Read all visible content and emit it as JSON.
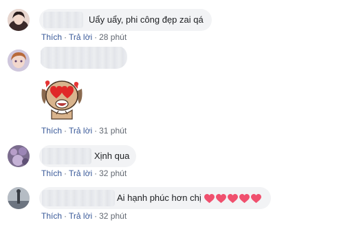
{
  "comments": [
    {
      "text": "Uẩy uẩy, phi công đẹp zai qá",
      "actions": {
        "like": "Thích",
        "reply": "Trả lời",
        "time": "28 phút"
      }
    },
    {
      "text": "",
      "sticker": "dog-heart-eyes-sticker",
      "actions": {
        "like": "Thích",
        "reply": "Trả lời",
        "time": "31 phút"
      }
    },
    {
      "text": "Xịnh qua",
      "actions": {
        "like": "Thích",
        "reply": "Trả lời",
        "time": "32 phút"
      }
    },
    {
      "text": "Ai hạnh phúc hơn chị",
      "emoji": "heart-emoji x5",
      "actions": {
        "like": "Thích",
        "reply": "Trả lời",
        "time": "32 phút"
      }
    }
  ],
  "colors": {
    "link": "#385898",
    "muted": "#616770",
    "bubble": "#f2f3f5",
    "heart": "#f0506e"
  },
  "separator": "·"
}
